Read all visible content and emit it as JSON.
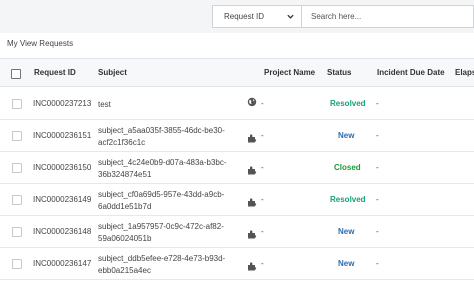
{
  "toolbar": {
    "filter_select_value": "Request ID",
    "search_placeholder": "Search here..."
  },
  "view_title": "My View Requests",
  "columns": [
    "Request ID",
    "Subject",
    "Project Name",
    "Status",
    "Incident Due Date",
    "Elaps"
  ],
  "rows": [
    {
      "id": "INC0000237213",
      "subject1": "test",
      "subject2": "",
      "icon": "globe-icon",
      "project": "-",
      "status": "Resolved",
      "status_kind": "resolved",
      "due": "-"
    },
    {
      "id": "INC0000236151",
      "subject1": "subject_a5aa035f-3855-46dc-be30-",
      "subject2": "acf2c1f36c1c",
      "icon": "puzzle-icon",
      "project": "-",
      "status": "New",
      "status_kind": "new",
      "due": "-"
    },
    {
      "id": "INC0000236150",
      "subject1": "subject_4c24e0b9-d07a-483a-b3bc-",
      "subject2": "36b324874e51",
      "icon": "puzzle-icon",
      "project": "-",
      "status": "Closed",
      "status_kind": "closed",
      "due": "-"
    },
    {
      "id": "INC0000236149",
      "subject1": "subject_cf0a69d5-957e-43dd-a9cb-",
      "subject2": "6a0dd1e51b7d",
      "icon": "puzzle-icon",
      "project": "-",
      "status": "Resolved",
      "status_kind": "resolved",
      "due": "-"
    },
    {
      "id": "INC0000236148",
      "subject1": "subject_1a957957-0c9c-472c-af82-",
      "subject2": "59a06024051b",
      "icon": "puzzle-icon",
      "project": "-",
      "status": "New",
      "status_kind": "new",
      "due": "-"
    },
    {
      "id": "INC0000236147",
      "subject1": "subject_ddb5efee-e728-4e73-b93d-",
      "subject2": "ebb0a215a4ec",
      "icon": "puzzle-icon",
      "project": "-",
      "status": "New",
      "status_kind": "new",
      "due": "-"
    }
  ],
  "colors": {
    "resolved": "#1aa07a",
    "new": "#2b6cb0",
    "closed": "#1f9a3c"
  }
}
